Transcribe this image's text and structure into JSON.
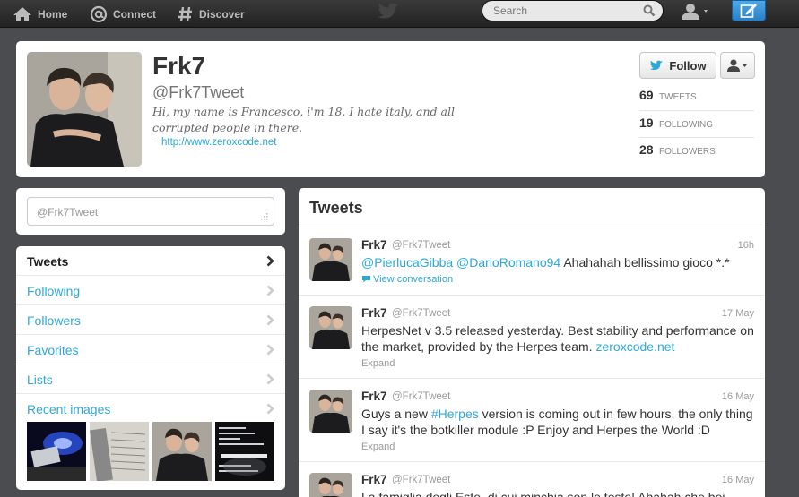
{
  "topbar": {
    "home": "Home",
    "connect": "Connect",
    "discover": "Discover",
    "search_placeholder": "Search"
  },
  "profile": {
    "name": "Frk7",
    "handle": "@Frk7Tweet",
    "bio": "Hi, my name is Francesco, i'm 18. I hate italy, and all corrupted people in there.",
    "url": "http://www.zeroxcode.net",
    "follow_label": "Follow",
    "stats": [
      {
        "num": "69",
        "label": "TWEETS"
      },
      {
        "num": "19",
        "label": "FOLLOWING"
      },
      {
        "num": "28",
        "label": "FOLLOWERS"
      }
    ]
  },
  "sidebar": {
    "tweet_to_placeholder": "@Frk7Tweet",
    "nav": [
      {
        "label": "Tweets"
      },
      {
        "label": "Following"
      },
      {
        "label": "Followers"
      },
      {
        "label": "Favorites"
      },
      {
        "label": "Lists"
      },
      {
        "label": "Recent images"
      }
    ]
  },
  "timeline": {
    "heading": "Tweets",
    "tweets": [
      {
        "name": "Frk7",
        "handle": "@Frk7Tweet",
        "time": "16h",
        "mention1": "@PierlucaGibba",
        "mention2": "@DarioRomano94",
        "text": " Ahahahah bellissimo gioco *.*",
        "action": "View conversation"
      },
      {
        "name": "Frk7",
        "handle": "@Frk7Tweet",
        "time": "17 May",
        "text": "HerpesNet v 3.5 released yesterday. Best stability and performance on the market, provided by the Herpes team. ",
        "link": "zeroxcode.net",
        "action": "Expand"
      },
      {
        "name": "Frk7",
        "handle": "@Frk7Tweet",
        "time": "16 May",
        "text_before": "Guys a new ",
        "hashtag": "#Herpes",
        "text_after": " version is coming out in few hours, the only thing I say it's the botkiller module :P Enjoy and Herpes the World :D",
        "action": "Expand"
      },
      {
        "name": "Frk7",
        "handle": "@Frk7Tweet",
        "time": "16 May",
        "text": "La famiglia degli Este, di cui minchia son le teste! Ahahah che bei"
      }
    ]
  },
  "colors": {
    "accent": "#2fa8d8",
    "background": "#4a4c4f",
    "topbar": "#2a2a2a"
  }
}
